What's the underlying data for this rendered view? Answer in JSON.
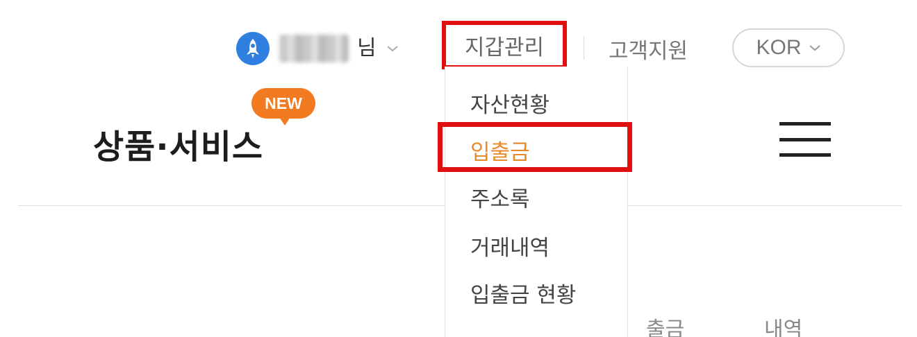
{
  "top_bar": {
    "user_suffix": "님",
    "wallet_menu_label": "지갑관리",
    "support_label": "고객지원",
    "language": "KOR"
  },
  "header": {
    "new_badge": "NEW",
    "nav_title": "상품·서비스"
  },
  "dropdown": {
    "items": [
      {
        "label": "자산현황"
      },
      {
        "label": "입출금"
      },
      {
        "label": "주소록"
      },
      {
        "label": "거래내역"
      },
      {
        "label": "입출금 현황"
      }
    ]
  },
  "colors": {
    "highlight_red": "#e01010",
    "active_orange": "#e88a2a",
    "badge_orange": "#f27a21",
    "avatar_blue": "#2f7fe0"
  }
}
